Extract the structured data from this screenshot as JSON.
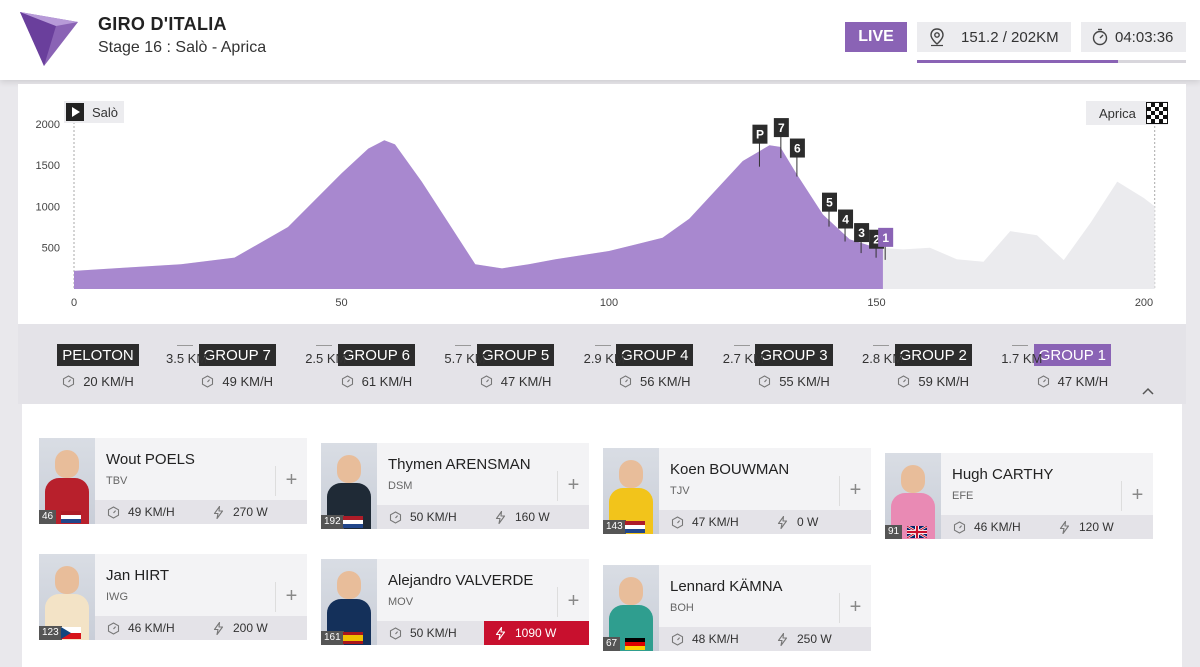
{
  "header": {
    "race_name": "GIRO D'ITALIA",
    "stage": "Stage 16 : Salò - Aprica",
    "live_label": "LIVE",
    "distance": "151.2 / 202KM",
    "elapsed_time": "04:03:36",
    "progress_fraction": 0.748,
    "accent_color": "#8a63b5"
  },
  "profile": {
    "start_label": "Salò",
    "finish_label": "Aprica",
    "x_ticks": [
      "0",
      "50",
      "100",
      "150",
      "200"
    ],
    "y_ticks": [
      "2000",
      "1500",
      "1000",
      "500"
    ],
    "current_km": 151.2,
    "total_km": 202,
    "elevation_km": [
      0,
      10,
      20,
      30,
      40,
      50,
      55,
      58,
      60,
      65,
      70,
      75,
      80,
      85,
      90,
      100,
      110,
      115,
      120,
      125,
      130,
      132,
      135,
      140,
      145,
      150,
      155,
      160,
      165,
      170,
      175,
      180,
      185,
      190,
      195,
      200,
      202
    ],
    "elevation_m": [
      220,
      260,
      300,
      380,
      750,
      1400,
      1700,
      1800,
      1750,
      1300,
      800,
      300,
      250,
      300,
      360,
      460,
      620,
      850,
      1200,
      1550,
      1740,
      1720,
      1400,
      900,
      600,
      500,
      480,
      500,
      360,
      330,
      700,
      650,
      350,
      800,
      1300,
      1100,
      1000
    ],
    "markers": [
      {
        "label": "P",
        "km": 127,
        "leader": false
      },
      {
        "label": "7",
        "km": 131,
        "leader": false
      },
      {
        "label": "6",
        "km": 134,
        "leader": false
      },
      {
        "label": "5",
        "km": 140,
        "leader": false
      },
      {
        "label": "4",
        "km": 143,
        "leader": false
      },
      {
        "label": "3",
        "km": 146,
        "leader": false
      },
      {
        "label": "2",
        "km": 148.8,
        "leader": false
      },
      {
        "label": "1",
        "km": 150.5,
        "leader": true
      }
    ]
  },
  "groups": [
    {
      "name": "PELOTON",
      "speed": "20 KM/H",
      "leader": false
    },
    {
      "name": "GROUP 7",
      "speed": "49 KM/H",
      "leader": false
    },
    {
      "name": "GROUP 6",
      "speed": "61 KM/H",
      "leader": false
    },
    {
      "name": "GROUP 5",
      "speed": "47 KM/H",
      "leader": false
    },
    {
      "name": "GROUP 4",
      "speed": "56 KM/H",
      "leader": false
    },
    {
      "name": "GROUP 3",
      "speed": "55 KM/H",
      "leader": false
    },
    {
      "name": "GROUP 2",
      "speed": "59 KM/H",
      "leader": false
    },
    {
      "name": "GROUP 1",
      "speed": "47 KM/H",
      "leader": true
    }
  ],
  "gaps": [
    "3.5  KM",
    "2.5  KM",
    "5.7  KM",
    "2.9  KM",
    "2.7  KM",
    "2.8  KM",
    "1.7  KM"
  ],
  "riders": [
    {
      "name": "Wout POELS",
      "team": "TBV",
      "number": "46",
      "nation": "nl",
      "kit": "#b8202c",
      "speed": "49 KM/H",
      "power": "270 W",
      "hot": false
    },
    {
      "name": "Thymen ARENSMAN",
      "team": "DSM",
      "number": "192",
      "nation": "nl",
      "kit": "#1f2a36",
      "speed": "50 KM/H",
      "power": "160 W",
      "hot": false
    },
    {
      "name": "Koen BOUWMAN",
      "team": "TJV",
      "number": "143",
      "nation": "nl",
      "kit": "#f2c41b",
      "speed": "47 KM/H",
      "power": "0 W",
      "hot": false
    },
    {
      "name": "Hugh CARTHY",
      "team": "EFE",
      "number": "91",
      "nation": "gb",
      "kit": "#e98ab4",
      "speed": "46 KM/H",
      "power": "120 W",
      "hot": false
    },
    {
      "name": "Jan HIRT",
      "team": "IWG",
      "number": "123",
      "nation": "cz",
      "kit": "#f3e3c6",
      "speed": "46 KM/H",
      "power": "200 W",
      "hot": false
    },
    {
      "name": "Alejandro VALVERDE",
      "team": "MOV",
      "number": "161",
      "nation": "es",
      "kit": "#14305a",
      "speed": "50 KM/H",
      "power": "1090 W",
      "hot": true
    },
    {
      "name": "Lennard KÄMNA",
      "team": "BOH",
      "number": "67",
      "nation": "de",
      "kit": "#2f9e8f",
      "speed": "48 KM/H",
      "power": "250 W",
      "hot": false
    }
  ]
}
